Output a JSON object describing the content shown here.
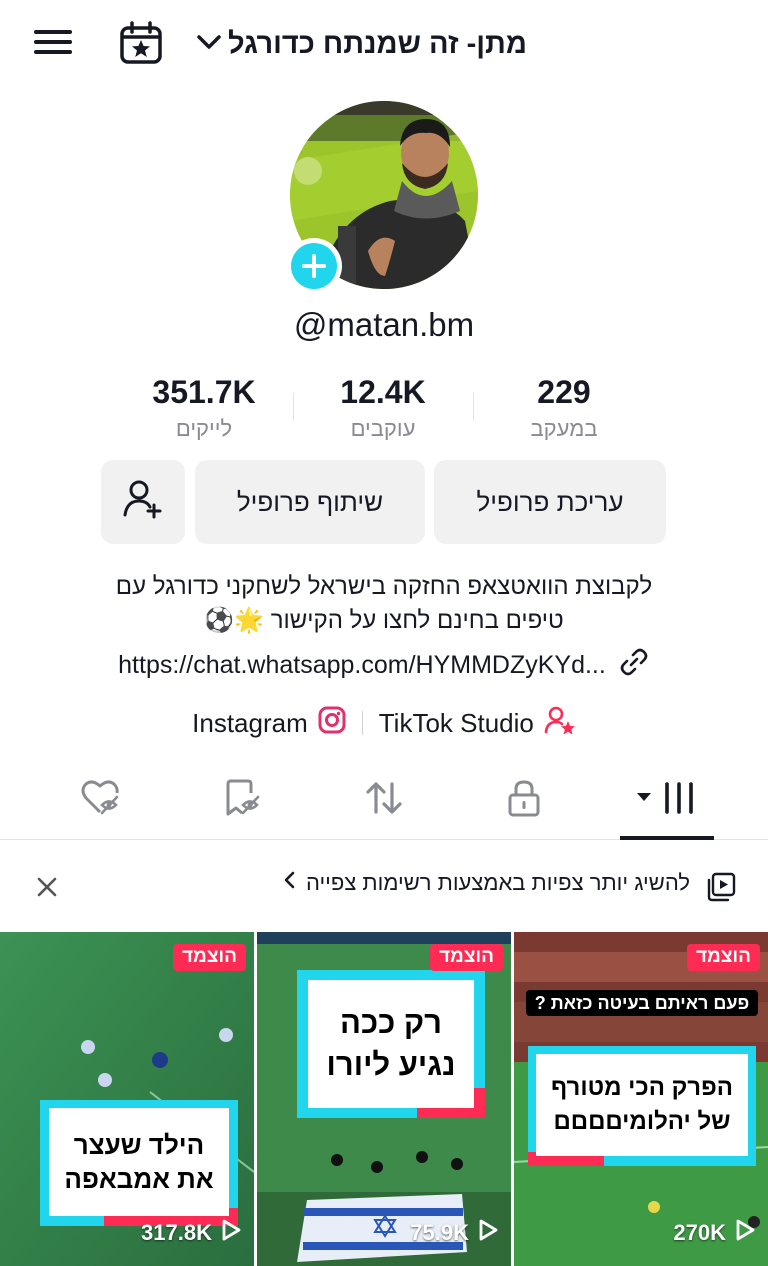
{
  "header": {
    "title": "מתן- זה שמנתח כדורגל",
    "menu_icon": "hamburger-menu-icon",
    "calendar_icon": "calendar-star-icon",
    "chevron_icon": "chevron-down-icon"
  },
  "profile": {
    "username": "@matan.bm",
    "add_photo_icon": "plus-icon"
  },
  "stats": {
    "following": {
      "value": "229",
      "label": "במעקב"
    },
    "followers": {
      "value": "12.4K",
      "label": "עוקבים"
    },
    "likes": {
      "value": "351.7K",
      "label": "לייקים"
    }
  },
  "actions": {
    "edit_profile": "עריכת פרופיל",
    "share_profile": "שיתוף פרופיל",
    "add_friend_icon": "add-user-icon"
  },
  "bio": {
    "line1": "לקבוצת הוואטצאפ החזקה בישראל לשחקני כדורגל עם",
    "line2": "טיפים בחינם לחצו על הקישור 🌟⚽",
    "link": "https://chat.whatsapp.com/HYMMDZyKYd...",
    "link_icon": "link-icon"
  },
  "socials": {
    "instagram": "Instagram",
    "tiktok_studio": "TikTok Studio"
  },
  "tabs": [
    {
      "name": "videos",
      "icon": "grid-icon"
    },
    {
      "name": "private",
      "icon": "lock-icon"
    },
    {
      "name": "reposts",
      "icon": "repost-icon"
    },
    {
      "name": "favorites",
      "icon": "bookmark-hidden-icon"
    },
    {
      "name": "liked",
      "icon": "heart-hidden-icon"
    }
  ],
  "banner": {
    "text": "להשיג יותר צפיות באמצעות רשימות צפייה",
    "icon": "playlist-icon"
  },
  "videos": [
    {
      "pinned_label": "הוצמד",
      "caption": "הפרק הכי מטורף של יהלומיםםםם",
      "top_caption": "פעם ראיתם בעיטה כזאת ?",
      "views": "270K"
    },
    {
      "pinned_label": "הוצמד",
      "caption": "רק ככה נגיע ליורו",
      "views": "75.9K"
    },
    {
      "pinned_label": "הוצמד",
      "caption": "הילד שעצר את אמבאפה",
      "views": "317.8K"
    }
  ]
}
